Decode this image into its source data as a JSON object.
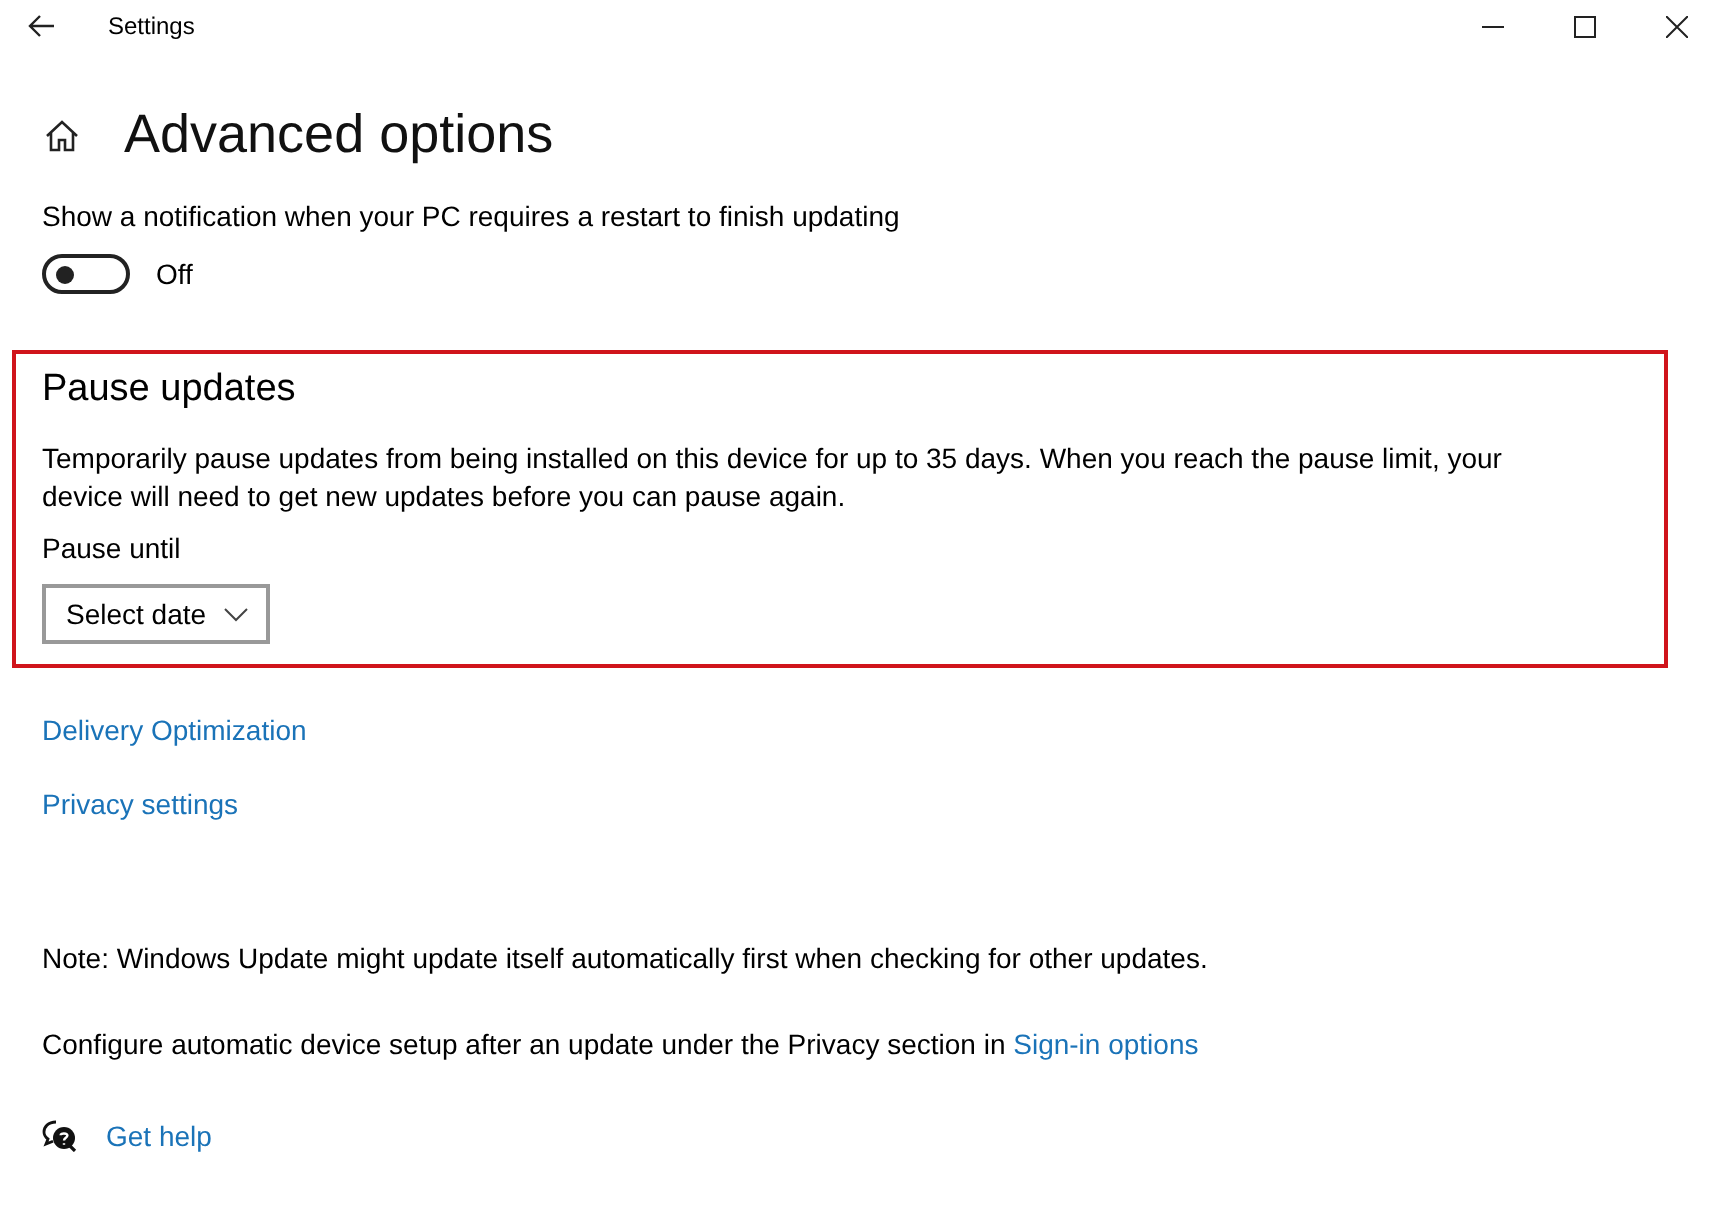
{
  "window": {
    "title": "Settings"
  },
  "page_title": "Advanced options",
  "restart_notification": {
    "label": "Show a notification when your PC requires a restart to finish updating",
    "on": false,
    "state_label": "Off"
  },
  "pause_updates": {
    "highlighted": true,
    "heading": "Pause updates",
    "description": "Temporarily pause updates from being installed on this device for up to 35 days. When you reach the pause limit, your device will need to get new updates before you can pause again.",
    "pause_until_label": "Pause until",
    "dropdown": "Select date"
  },
  "links": [
    "Delivery Optimization",
    "Privacy settings"
  ],
  "note": "Note: Windows Update might update itself automatically first when checking for other updates.",
  "configure": {
    "text": "Configure automatic device setup after an update under the Privacy section in",
    "link": "Sign-in options"
  },
  "help_link": "Get help"
}
